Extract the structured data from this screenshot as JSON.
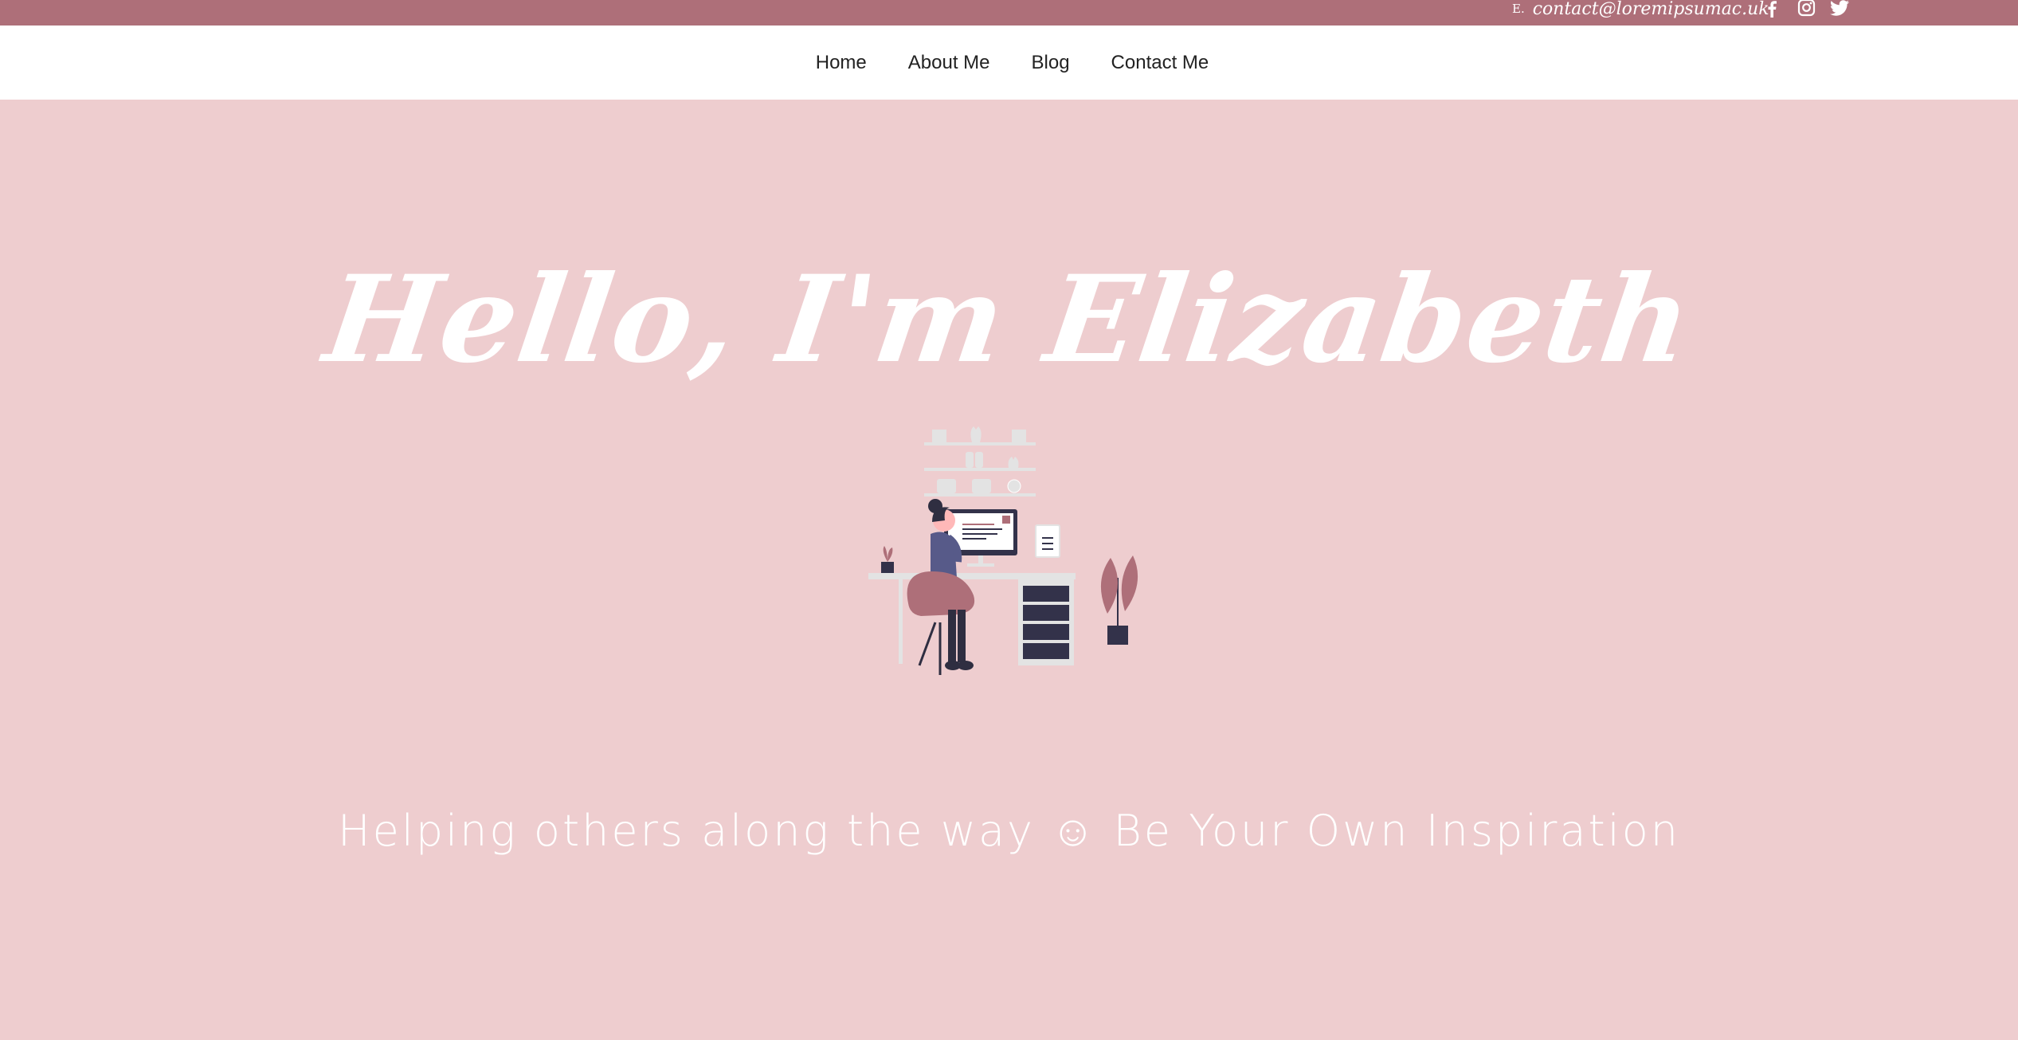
{
  "topbar": {
    "contact_prefix": "E.",
    "contact_email": "contact@loremipsumac.uk",
    "social_icons": [
      "facebook-icon",
      "instagram-icon",
      "twitter-icon"
    ],
    "background_color": "#ae6f79"
  },
  "nav": {
    "items": [
      "Home",
      "About Me",
      "Blog",
      "Contact Me"
    ]
  },
  "hero": {
    "headline": "Hello, I'm Elizabeth",
    "illustration": "woman-at-desk-illustration",
    "tagline": "Helping others along the way ☺ Be Your Own Inspiration",
    "background_color": "#eecdcf"
  }
}
